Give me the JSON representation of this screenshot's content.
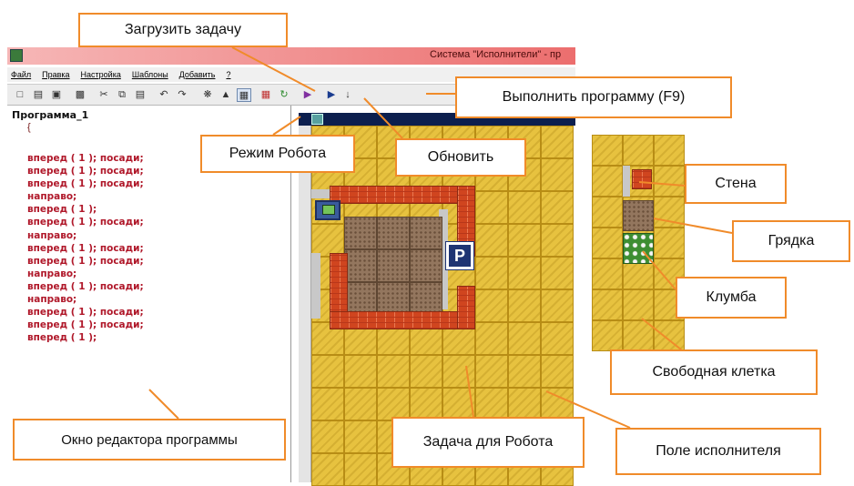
{
  "window": {
    "title": "Система \"Исполнители\" - пр",
    "menu": [
      "Файл",
      "Правка",
      "Настройка",
      "Шаблоны",
      "Добавить",
      "?"
    ]
  },
  "toolbar": {
    "icons": [
      "new-file-icon",
      "open-folder-icon",
      "save-icon",
      "print-icon",
      "cut-icon",
      "copy-icon",
      "paste-icon",
      "undo-icon",
      "redo-icon",
      "bug-icon",
      "load-task-icon",
      "robot-mode-icon",
      "grid-icon",
      "refresh-icon",
      "export-icon",
      "run-icon",
      "step-icon"
    ]
  },
  "editor": {
    "program_name": "Программа_1",
    "open_brace": "{",
    "close_brace": "}",
    "lines": [
      "вперед ( 1 ); посади;",
      "вперед ( 1 ); посади;",
      "вперед ( 1 ); посади;",
      "направо;",
      "вперед ( 1 );",
      "вперед ( 1 ); посади;",
      "направо;",
      "вперед ( 1 ); посади;",
      "вперед ( 1 ); посади;",
      "направо;",
      "вперед ( 1 ); посади;",
      "направо;",
      "вперед ( 1 ); посади;",
      "вперед ( 1 ); посади;",
      "вперед ( 1 );"
    ]
  },
  "field": {
    "finish_marker": "P",
    "colors": {
      "free": "#e7c23f",
      "wall": "#d0451f",
      "bed": "#93765e",
      "flowerbed": "#3d8e32"
    }
  },
  "callouts": {
    "load_task": "Загрузить задачу",
    "run_program": "Выполнить программу (F9)",
    "robot_mode": "Режим Робота",
    "refresh": "Обновить",
    "wall": "Стена",
    "bed": "Грядка",
    "flowerbed": "Клумба",
    "free_cell": "Свободная клетка",
    "editor_window": "Окно редактора программы",
    "robot_task": "Задача для Робота",
    "executor_field": "Поле исполнителя"
  }
}
